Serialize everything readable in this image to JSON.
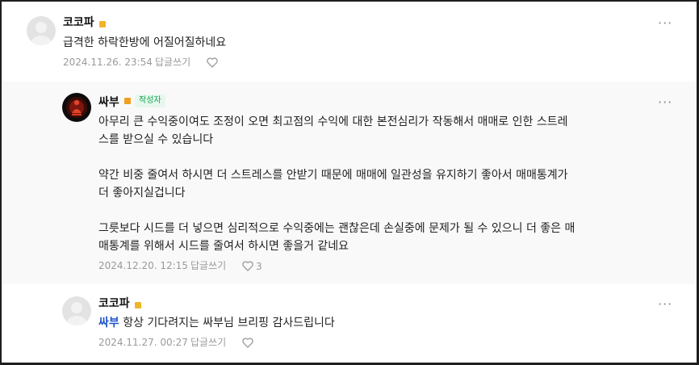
{
  "comments": [
    {
      "nickname": "코코파",
      "text": "급격한 하락한방에 어질어질하네요",
      "timestamp": "2024.11.26. 23:54",
      "reply_label": "답글쓰기",
      "avatar_icon": "default-profile-icon",
      "badge_color": "#f0b429"
    },
    {
      "nickname": "싸부",
      "writer_badge": "작성자",
      "paragraphs": [
        [
          "아무리 큰 수익중이여도 조정이 오면 최고점의 수익에 대한 본전심리가 작동해서 매매로 인한 스트레",
          "스를 받으실 수 있습니다"
        ],
        [
          "약간 비중 줄여서 하시면 더 스트레스를 안받기 때문에 매매에 일관성을 유지하기 좋아서 매매통계가",
          "더 좋아지실겁니다"
        ],
        [
          "그릇보다 시드를 더 넣으면 심리적으로 수익중에는 괜찮은데 손실중에 문제가 될 수 있으니 더 좋은 매",
          "매통계를 위해서 시드를 줄여서 하시면 좋을거 같네요"
        ]
      ],
      "timestamp": "2024.12.20. 12:15",
      "reply_label": "답글쓰기",
      "like_count": "3",
      "avatar_icon": "buddha-profile-icon",
      "badge_color": "#f0a020",
      "writer_badge_color": "#14a44d"
    },
    {
      "nickname": "코코파",
      "mention": "싸부",
      "text": "항상 기다려지는 싸부님 브리핑 감사드립니다",
      "timestamp": "2024.11.27. 00:27",
      "reply_label": "답글쓰기",
      "avatar_icon": "default-profile-icon",
      "badge_color": "#f0b429",
      "mention_color": "#1f55c8"
    }
  ],
  "more_label": "···"
}
